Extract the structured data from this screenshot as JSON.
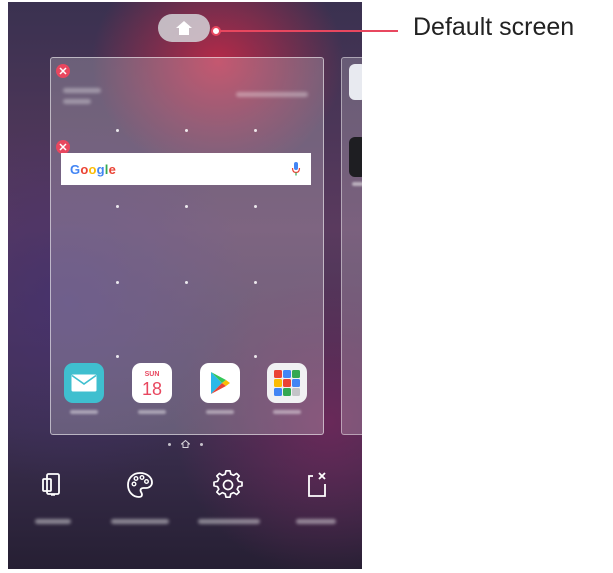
{
  "callout": {
    "label": "Default screen"
  },
  "search_widget": {
    "logo": [
      "G",
      "o",
      "o",
      "g",
      "l",
      "e"
    ]
  },
  "home_apps": [
    {
      "name": "Email",
      "icon": "mail-icon",
      "color": "#3fbfcf"
    },
    {
      "name": "Calendar",
      "icon": "calendar-icon",
      "day": "SUN",
      "date": "18"
    },
    {
      "name": "Play Store",
      "icon": "play-store-icon"
    },
    {
      "name": "Google",
      "icon": "folder-icon"
    }
  ],
  "bottom_tray": [
    {
      "icon": "widgets-icon"
    },
    {
      "icon": "palette-icon"
    },
    {
      "icon": "settings-gear-icon"
    },
    {
      "icon": "app-trash-icon"
    }
  ],
  "colors": {
    "remove_badge": "#e8475f",
    "callout_line": "#e8475f"
  }
}
